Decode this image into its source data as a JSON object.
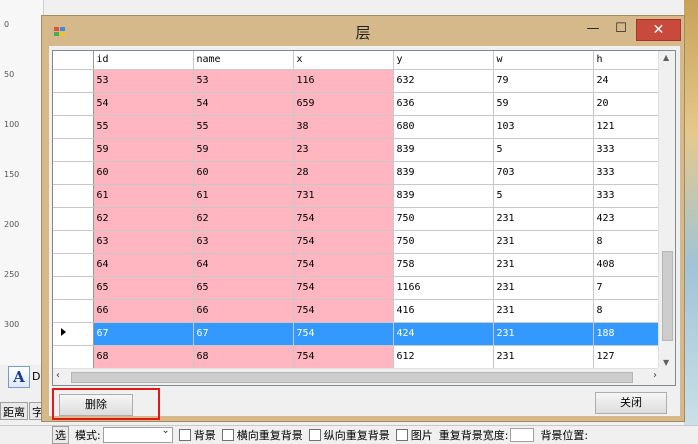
{
  "window": {
    "title": "层",
    "min_glyph": "—",
    "max_glyph": "☐",
    "close_glyph": "✕"
  },
  "grid": {
    "columns": [
      "",
      "id",
      "name",
      "x",
      "y",
      "w",
      "h"
    ],
    "rows": [
      {
        "id": "53",
        "name": "53",
        "x": "116",
        "y": "632",
        "w": "79",
        "h": "24"
      },
      {
        "id": "54",
        "name": "54",
        "x": "659",
        "y": "636",
        "w": "59",
        "h": "20"
      },
      {
        "id": "55",
        "name": "55",
        "x": "38",
        "y": "680",
        "w": "103",
        "h": "121"
      },
      {
        "id": "59",
        "name": "59",
        "x": "23",
        "y": "839",
        "w": "5",
        "h": "333"
      },
      {
        "id": "60",
        "name": "60",
        "x": "28",
        "y": "839",
        "w": "703",
        "h": "333"
      },
      {
        "id": "61",
        "name": "61",
        "x": "731",
        "y": "839",
        "w": "5",
        "h": "333"
      },
      {
        "id": "62",
        "name": "62",
        "x": "754",
        "y": "750",
        "w": "231",
        "h": "423"
      },
      {
        "id": "63",
        "name": "63",
        "x": "754",
        "y": "750",
        "w": "231",
        "h": "8"
      },
      {
        "id": "64",
        "name": "64",
        "x": "754",
        "y": "758",
        "w": "231",
        "h": "408"
      },
      {
        "id": "65",
        "name": "65",
        "x": "754",
        "y": "1166",
        "w": "231",
        "h": "7"
      },
      {
        "id": "66",
        "name": "66",
        "x": "754",
        "y": "416",
        "w": "231",
        "h": "8"
      },
      {
        "id": "67",
        "name": "67",
        "x": "754",
        "y": "424",
        "w": "231",
        "h": "188",
        "selected": true
      },
      {
        "id": "68",
        "name": "68",
        "x": "754",
        "y": "612",
        "w": "231",
        "h": "127"
      }
    ],
    "highlight_color": "#ffb6c1",
    "selection_color": "#3399ff"
  },
  "buttons": {
    "delete": "删除",
    "close": "关闭"
  },
  "background": {
    "ruler_marks": [
      "0",
      "50",
      "100",
      "150",
      "200",
      "250",
      "300"
    ],
    "a_label": "D",
    "left_tabs": [
      "距离",
      "字"
    ],
    "bottom": {
      "select_label": "选",
      "mode_label": "模式:",
      "bg_label": "背景",
      "repeat_x_label": "横向重复背景",
      "repeat_y_label": "纵向重复背景",
      "image_label": "图片",
      "repeat_width_label": "重复背景宽度:",
      "bg_position_label": "背景位置:"
    }
  }
}
